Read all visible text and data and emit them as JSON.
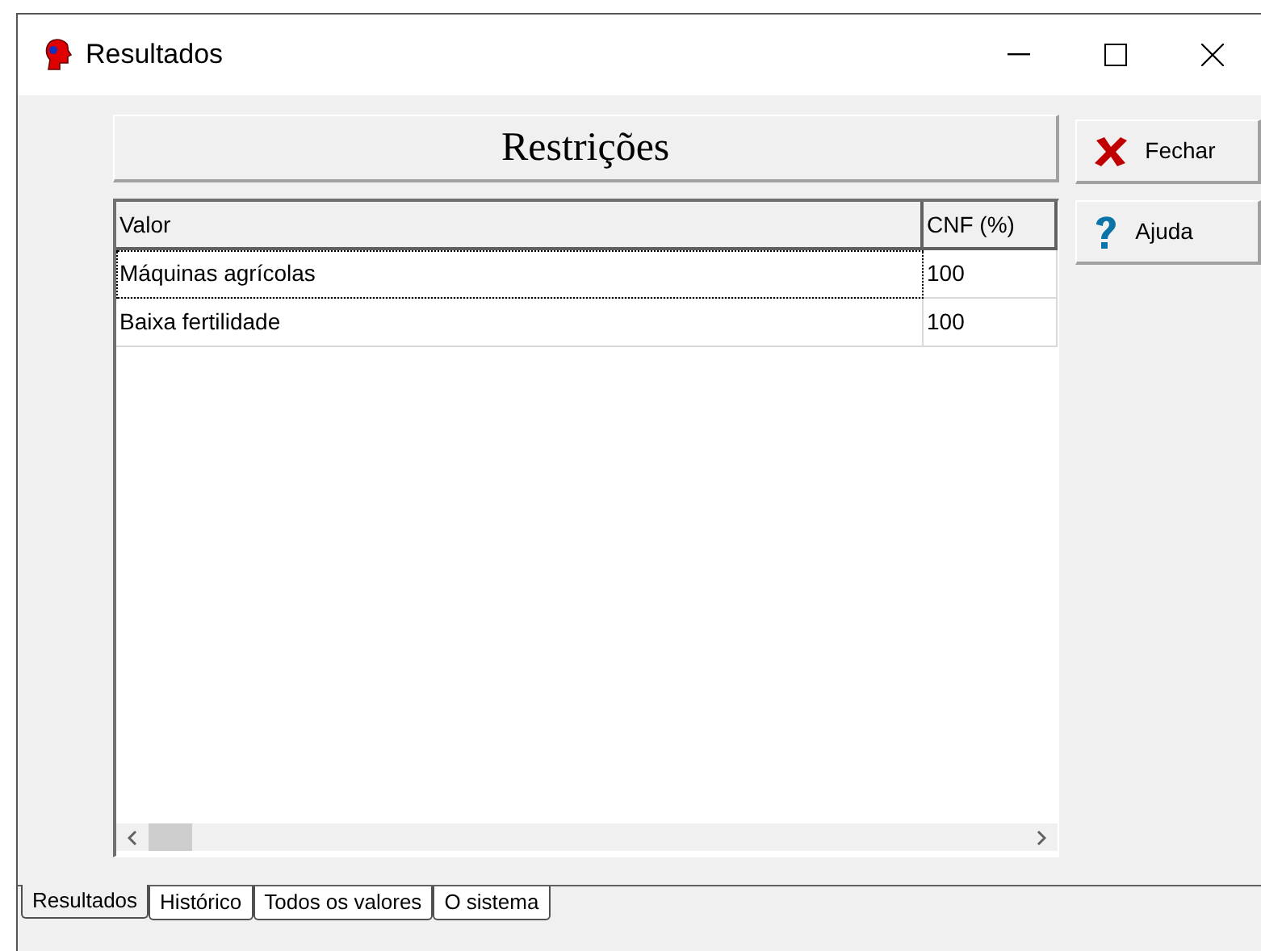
{
  "window": {
    "title": "Resultados"
  },
  "panel_title": "Restrições",
  "table": {
    "columns": [
      "Valor",
      "CNF (%)"
    ],
    "rows": [
      {
        "cells": [
          "Máquinas agrícolas",
          "100"
        ],
        "selected": true
      },
      {
        "cells": [
          "Baixa fertilidade",
          "100"
        ],
        "selected": false
      }
    ]
  },
  "buttons": [
    {
      "label": "Fechar",
      "kind": "close"
    },
    {
      "label": "Ajuda",
      "kind": "help"
    }
  ],
  "tabs": [
    {
      "label": "Resultados",
      "selected": true
    },
    {
      "label": "Histórico",
      "selected": false
    },
    {
      "label": "Todos os valores",
      "selected": false
    },
    {
      "label": "O sistema",
      "selected": false
    }
  ]
}
